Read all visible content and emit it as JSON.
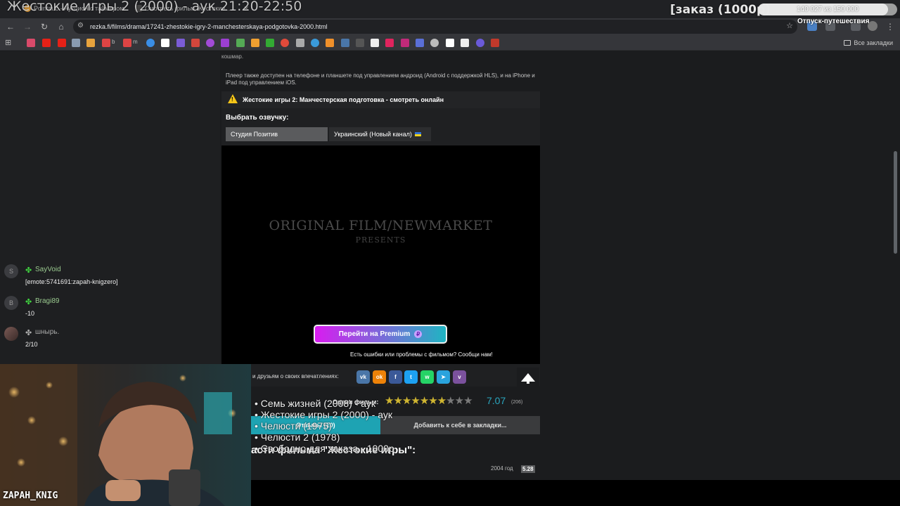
{
  "browser": {
    "tabs": [
      {
        "label": "Pointauc - Аукцион с таймером"
      },
      {
        "label": "Смотреть фильм Жестокие..."
      }
    ],
    "url": "rezka.fi/films/drama/17241-zhestokie-igry-2-manchesterskaya-podgotovka-2000.html",
    "bookmarks_bar_label": "Все закладки",
    "bookmark_labels": [
      "b",
      "m"
    ]
  },
  "overlay": {
    "title": "Жестокие игры 2 (2000) - аук 21:20-22:50",
    "order_label": "[заказ (1000р)",
    "progress_text": "140 027 из 150 000",
    "progress_fraction": 0.933,
    "goal_label": "Отпуск-путешествия"
  },
  "page": {
    "top_fragment": "кошмар.",
    "player_note": "Плеер также доступен на телефоне и планшете под управлением андроид (Android с поддержкой HLS), и на iPhone и iPad под управлением iOS.",
    "watch_title": "Жестокие игры 2: Манчестерская подготовка - смотреть онлайн",
    "voice_label": "Выбрать озвучку:",
    "voices": [
      "Студия Позитив",
      "Украинский (Новый канал)"
    ],
    "player": {
      "title_line": "ORIGINAL FILM/NEWMARKET",
      "sub_line": "PRESENTS"
    },
    "premium_button": "Перейти на Premium",
    "report_text": "Есть ошибки или проблемы с фильмом? Сообщи нам!",
    "share_text": "и друзьям о своих впечатлениях:",
    "social": [
      "vk-icon",
      "ok-icon",
      "facebook-icon",
      "twitter-icon",
      "whatsapp-icon",
      "telegram-icon",
      "viber-icon"
    ],
    "rating_label": "Оцени фильм:",
    "rating_stars_on": 7,
    "rating_stars_total": 10,
    "rating_value": "7.07",
    "rating_count": "(206)",
    "tab_reviews": "Отзывы (10)",
    "tab_bookmarks": "Добавить к себе в закладки...",
    "parts_heading": "асти фильма \"Жестокие игры\":",
    "year_label": "2004 год",
    "year_badge": "5.28"
  },
  "queue": [
    "• Семь жизней (2008) - аук",
    "• Жестокие игры 2 (2000) - аук",
    "• Челюсти (1975)",
    "• Челюсти 2 (1978)",
    "• Свободно для заказа - 1000р"
  ],
  "chat": [
    {
      "avatar": "S",
      "user": "SayVoid",
      "text": "[emote:5741691:zapah-knigzero]"
    },
    {
      "avatar": "B",
      "user": "Bragi89",
      "text": "-10"
    },
    {
      "avatar": "",
      "user": "шнырь.",
      "text": "2/10"
    }
  ],
  "webcam": {
    "name": "ZAPAH_KNIG"
  },
  "colors": {
    "accent": "#1ea3b3",
    "premium_start": "#d91cf0",
    "premium_end": "#1fb5c2",
    "rating": "#2aa6bf",
    "star_on": "#cfb531"
  }
}
